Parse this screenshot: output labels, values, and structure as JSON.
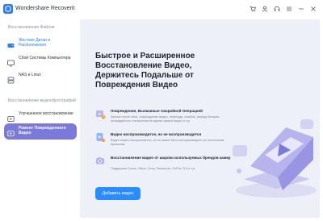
{
  "app": {
    "title": "Wondershare Recoverit"
  },
  "sidebar": {
    "section_files": "Восстановление Файлов",
    "items_files": [
      {
        "label": "Жесткие Диски и Расположения"
      },
      {
        "label": "Сбой Системы Компьютера"
      },
      {
        "label": "NAS и Linux"
      }
    ],
    "section_video": "Восстановление видео/фотографий",
    "items_video": [
      {
        "label": "Улучшенное восстановление"
      },
      {
        "label": "Ремонт Поврежденного Видео"
      }
    ]
  },
  "main": {
    "headline": "Быстрое и Расширенное Восстановление Видео, Держитесь Подальше от Повреждения Видео",
    "features": [
      {
        "title": "Повреждения, Вызванные Аварийной Операцией",
        "desc": "Записи после сбоя, повреждение видео, перехода, ошибок, разряд батареи, неожиданного отключения во время записи видео и т.д."
      },
      {
        "title": "Видео воспроизводится, но не воспроизводится",
        "desc": "Видео можно воспроизвести, но не может быть воспроизведено по нескольким причинам."
      },
      {
        "title": "Восстановление видео от широко используемых брендов камер",
        "desc": "Поддержка Canon, Nikon, Sony, Panasonic, GoPro, DJI и т.д."
      }
    ],
    "cta_label": "Добавить видео"
  },
  "colors": {
    "accent": "#2a8cff",
    "sidebar_active": "#7b79d9",
    "main_bg": "#eef0f8"
  }
}
